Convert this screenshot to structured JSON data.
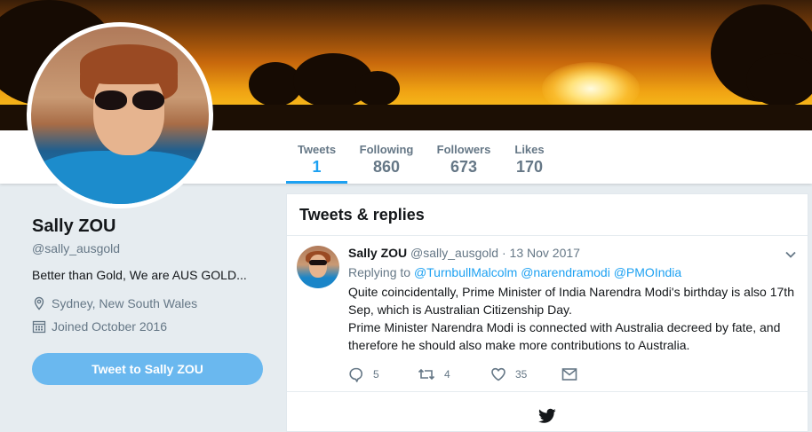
{
  "nav": {
    "items": [
      {
        "label": "Tweets",
        "value": "1"
      },
      {
        "label": "Following",
        "value": "860"
      },
      {
        "label": "Followers",
        "value": "673"
      },
      {
        "label": "Likes",
        "value": "170"
      }
    ]
  },
  "profile": {
    "name": "Sally ZOU",
    "handle": "@sally_ausgold",
    "bio": "Better than Gold, We are AUS GOLD...",
    "location": "Sydney, New South Wales",
    "joined": "Joined October 2016",
    "tweet_to_label": "Tweet to Sally ZOU"
  },
  "timeline": {
    "title": "Tweets & replies",
    "tweets": [
      {
        "name": "Sally ZOU",
        "handle": "@sally_ausgold",
        "separator": "·",
        "date": "13 Nov 2017",
        "replying_prefix": "Replying to",
        "mentions": [
          "@TurnbullMalcolm",
          "@narendramodi",
          "@PMOIndia"
        ],
        "text_line1": "Quite coincidentally, Prime Minister of India Narendra Modi's birthday is also 17th Sep, which is Australian Citizenship Day.",
        "text_line2": "Prime Minister Narendra Modi is connected with Australia decreed by fate, and therefore he should also make more contributions to Australia.",
        "replies": "5",
        "retweets": "4",
        "likes": "35"
      }
    ]
  },
  "colors": {
    "accent": "#1da1f2",
    "button": "#6ab8ef",
    "muted": "#657786",
    "background": "#e6ecf0"
  },
  "icons": [
    "location-icon",
    "calendar-icon",
    "chevron-down-icon",
    "reply-icon",
    "retweet-icon",
    "like-icon",
    "dm-icon",
    "twitter-bird-icon"
  ]
}
